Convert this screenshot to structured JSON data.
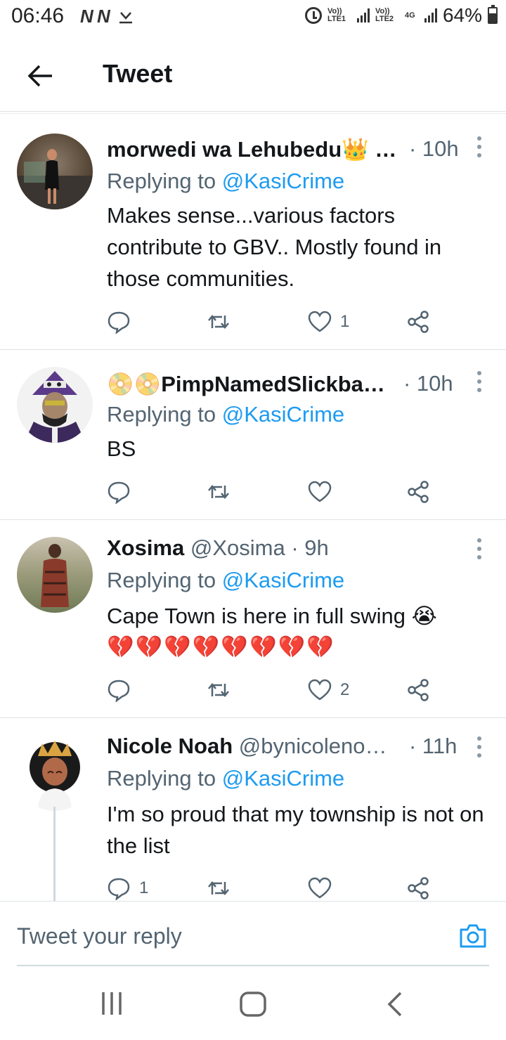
{
  "status_bar": {
    "time": "06:46",
    "left_icons": "N N",
    "sim1": "Vo)) LTE1",
    "sim2": "Vo)) LTE2",
    "net": "4G",
    "battery": "64%",
    "battery_level": 0.64
  },
  "header": {
    "title": "Tweet"
  },
  "tweets": [
    {
      "name": "morwedi wa Lehubedu👑 …",
      "handle": "",
      "time": "· 10h",
      "replying_prefix": "Replying to ",
      "replying_to": "@KasiCrime",
      "text": "Makes sense...various factors contribute to GBV.. Mostly found in those communities.",
      "reply_count": "",
      "retweet_count": "",
      "like_count": "1"
    },
    {
      "name": "📀📀PimpNamedSlickba…",
      "handle": "",
      "time": "· 10h",
      "replying_prefix": "Replying to ",
      "replying_to": "@KasiCrime",
      "text": "BS",
      "reply_count": "",
      "retweet_count": "",
      "like_count": ""
    },
    {
      "name": "Xosima",
      "handle": "@Xosima",
      "time": "· 9h",
      "replying_prefix": "Replying to ",
      "replying_to": "@KasiCrime",
      "text": "Cape Town is here in full swing 😭",
      "text2": "💔💔💔💔💔💔💔💔",
      "reply_count": "",
      "retweet_count": "",
      "like_count": "2"
    },
    {
      "name": "Nicole Noah",
      "handle": "@bynicoleno…",
      "time": "· 11h",
      "replying_prefix": "Replying to ",
      "replying_to": "@KasiCrime",
      "text": "I'm so proud that my township is not on the list",
      "reply_count": "1",
      "retweet_count": "",
      "like_count": ""
    }
  ],
  "reply_bar": {
    "placeholder": "Tweet your reply"
  },
  "icons": {
    "back": "arrow-left-icon",
    "more": "more-vertical-icon",
    "reply": "comment-icon",
    "retweet": "retweet-icon",
    "like": "heart-icon",
    "share": "share-icon",
    "camera": "camera-icon"
  },
  "colors": {
    "accent": "#1d9bf0",
    "secondary_text": "#536471",
    "primary_text": "#14171a"
  }
}
